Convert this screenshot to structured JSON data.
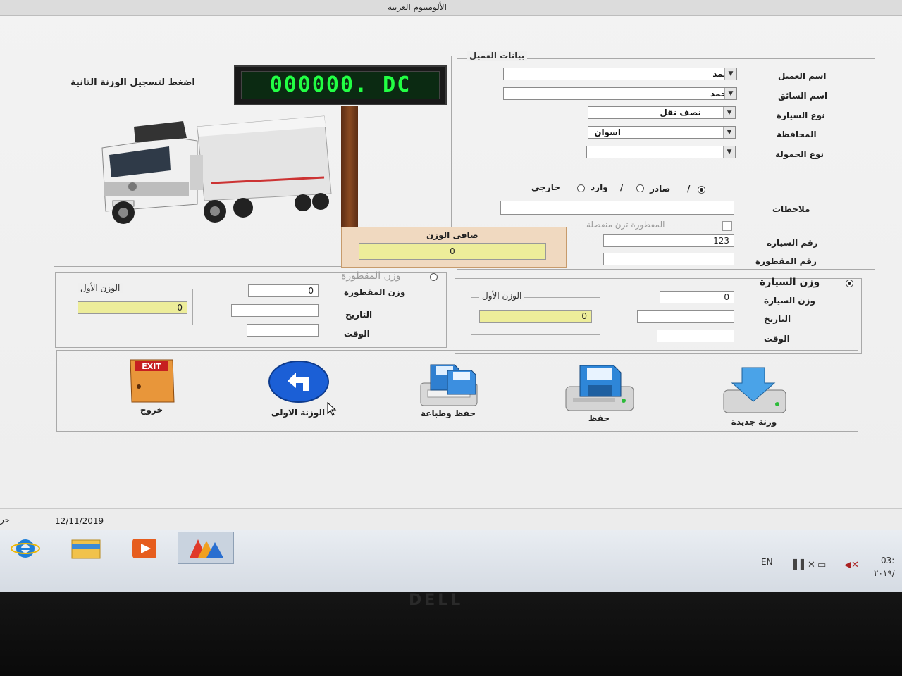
{
  "window": {
    "title": "الألومنيوم العربية"
  },
  "scale_display": {
    "prompt": "اضغط لتسجيل الوزنة الثانية",
    "reading": "000000. DC"
  },
  "customer_panel": {
    "title": "بيانات العميل",
    "customer_name_label": "اسم العميل",
    "customer_name_value": "احمد",
    "driver_name_label": "اسم السائق",
    "driver_name_value": "محمد",
    "vehicle_type_label": "نوع السيارة",
    "vehicle_type_value": "نصف نقل",
    "governorate_label": "المحافظة",
    "governorate_value": "اسوان",
    "load_type_label": "نوع الحمولة",
    "load_type_value": "",
    "direction_outgoing": "صادر",
    "direction_incoming": "وارد",
    "direction_external": "خارجي",
    "notes_label": "ملاحظات",
    "separate_trailer_label": "المقطورة تزن منفصلة",
    "vehicle_number_label": "رقم السيارة",
    "vehicle_number_value": "123",
    "trailer_number_label": "رقم المقطورة"
  },
  "net_weight": {
    "label": "صافى الوزن",
    "value": "0"
  },
  "trailer_weight_panel": {
    "title": "وزن المقطورة",
    "weight_label": "وزن المقطورة",
    "weight_value": "0",
    "date_label": "التاريخ",
    "time_label": "الوقت",
    "first_weight_title": "الوزن الأول",
    "first_weight_value": "0"
  },
  "vehicle_weight_panel": {
    "title": "وزن السيارة",
    "weight_label": "وزن السيارة",
    "weight_value": "0",
    "date_label": "التاريخ",
    "time_label": "الوقت",
    "first_weight_title": "الوزن الأول",
    "first_weight_value": "0"
  },
  "actions": {
    "exit_label": "خروج",
    "first_weighing_label": "الوزنة الاولى",
    "save_print_label": "حفظ وطباعة",
    "save_label": "حفظ",
    "new_weighing_label": "وزنة جديدة"
  },
  "status": {
    "date": "12/11/2019",
    "left_fragment": "حر"
  },
  "taskbar": {
    "language": "EN",
    "clock_time": "03:",
    "clock_date": "٢٠١٩/"
  },
  "icons": {
    "ie": "internet-explorer-icon",
    "explorer": "file-explorer-icon",
    "media": "media-player-icon",
    "app": "weighbridge-app-icon"
  },
  "bezel_brand": "DELL"
}
